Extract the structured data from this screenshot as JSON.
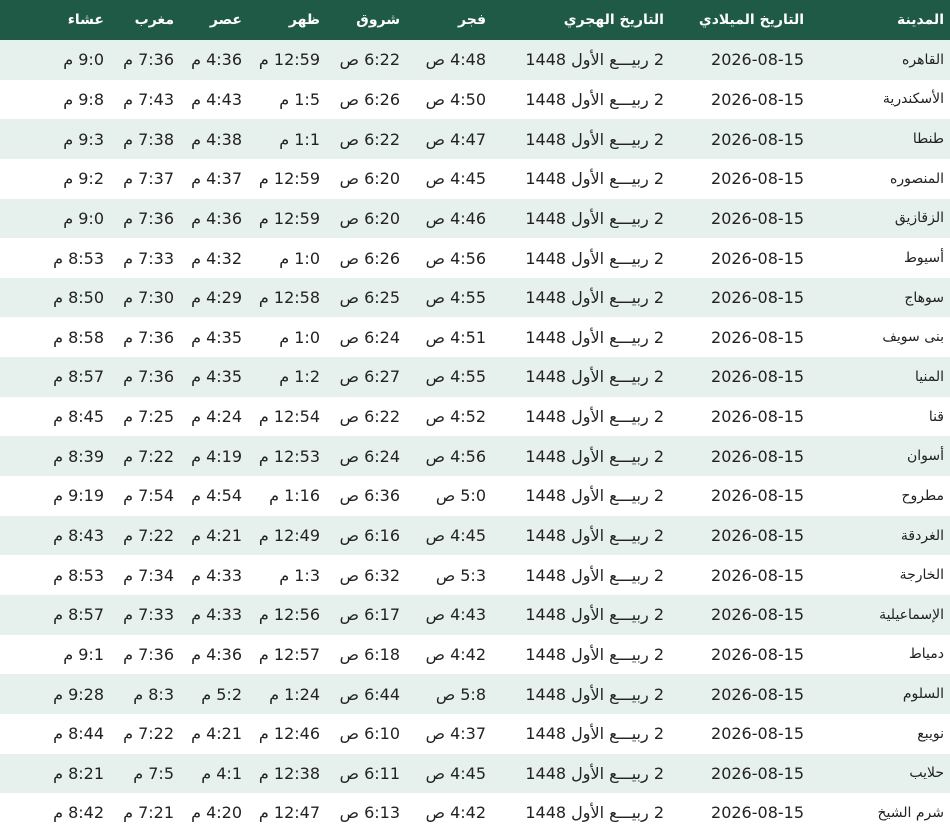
{
  "headers": {
    "city": "المدينة",
    "gregorian": "التاريخ الميلادي",
    "hijri": "التاريخ الهجري",
    "fajr": "فجر",
    "shuruq": "شروق",
    "dhuhr": "ظهر",
    "asr": "عصر",
    "maghrib": "مغرب",
    "isha": "عشاء"
  },
  "rows": [
    {
      "city": "القاهره",
      "gregorian": "2026-08-15",
      "hijri": "2 ربيـــع الأول 1448",
      "fajr": "4:48 ص",
      "shuruq": "6:22 ص",
      "dhuhr": "12:59 م",
      "asr": "4:36 م",
      "maghrib": "7:36 م",
      "isha": "9:0 م"
    },
    {
      "city": "الأسكندرية",
      "gregorian": "2026-08-15",
      "hijri": "2 ربيـــع الأول 1448",
      "fajr": "4:50 ص",
      "shuruq": "6:26 ص",
      "dhuhr": "1:5 م",
      "asr": "4:43 م",
      "maghrib": "7:43 م",
      "isha": "9:8 م"
    },
    {
      "city": "طنطا",
      "gregorian": "2026-08-15",
      "hijri": "2 ربيـــع الأول 1448",
      "fajr": "4:47 ص",
      "shuruq": "6:22 ص",
      "dhuhr": "1:1 م",
      "asr": "4:38 م",
      "maghrib": "7:38 م",
      "isha": "9:3 م"
    },
    {
      "city": "المنصوره",
      "gregorian": "2026-08-15",
      "hijri": "2 ربيـــع الأول 1448",
      "fajr": "4:45 ص",
      "shuruq": "6:20 ص",
      "dhuhr": "12:59 م",
      "asr": "4:37 م",
      "maghrib": "7:37 م",
      "isha": "9:2 م"
    },
    {
      "city": "الزقازيق",
      "gregorian": "2026-08-15",
      "hijri": "2 ربيـــع الأول 1448",
      "fajr": "4:46 ص",
      "shuruq": "6:20 ص",
      "dhuhr": "12:59 م",
      "asr": "4:36 م",
      "maghrib": "7:36 م",
      "isha": "9:0 م"
    },
    {
      "city": "أسيوط",
      "gregorian": "2026-08-15",
      "hijri": "2 ربيـــع الأول 1448",
      "fajr": "4:56 ص",
      "shuruq": "6:26 ص",
      "dhuhr": "1:0 م",
      "asr": "4:32 م",
      "maghrib": "7:33 م",
      "isha": "8:53 م"
    },
    {
      "city": "سوهاج",
      "gregorian": "2026-08-15",
      "hijri": "2 ربيـــع الأول 1448",
      "fajr": "4:55 ص",
      "shuruq": "6:25 ص",
      "dhuhr": "12:58 م",
      "asr": "4:29 م",
      "maghrib": "7:30 م",
      "isha": "8:50 م"
    },
    {
      "city": "بنى سويف",
      "gregorian": "2026-08-15",
      "hijri": "2 ربيـــع الأول 1448",
      "fajr": "4:51 ص",
      "shuruq": "6:24 ص",
      "dhuhr": "1:0 م",
      "asr": "4:35 م",
      "maghrib": "7:36 م",
      "isha": "8:58 م"
    },
    {
      "city": "المنيا",
      "gregorian": "2026-08-15",
      "hijri": "2 ربيـــع الأول 1448",
      "fajr": "4:55 ص",
      "shuruq": "6:27 ص",
      "dhuhr": "1:2 م",
      "asr": "4:35 م",
      "maghrib": "7:36 م",
      "isha": "8:57 م"
    },
    {
      "city": "قنا",
      "gregorian": "2026-08-15",
      "hijri": "2 ربيـــع الأول 1448",
      "fajr": "4:52 ص",
      "shuruq": "6:22 ص",
      "dhuhr": "12:54 م",
      "asr": "4:24 م",
      "maghrib": "7:25 م",
      "isha": "8:45 م"
    },
    {
      "city": "أسوان",
      "gregorian": "2026-08-15",
      "hijri": "2 ربيـــع الأول 1448",
      "fajr": "4:56 ص",
      "shuruq": "6:24 ص",
      "dhuhr": "12:53 م",
      "asr": "4:19 م",
      "maghrib": "7:22 م",
      "isha": "8:39 م"
    },
    {
      "city": "مطروح",
      "gregorian": "2026-08-15",
      "hijri": "2 ربيـــع الأول 1448",
      "fajr": "5:0 ص",
      "shuruq": "6:36 ص",
      "dhuhr": "1:16 م",
      "asr": "4:54 م",
      "maghrib": "7:54 م",
      "isha": "9:19 م"
    },
    {
      "city": "الغردقة",
      "gregorian": "2026-08-15",
      "hijri": "2 ربيـــع الأول 1448",
      "fajr": "4:45 ص",
      "shuruq": "6:16 ص",
      "dhuhr": "12:49 م",
      "asr": "4:21 م",
      "maghrib": "7:22 م",
      "isha": "8:43 م"
    },
    {
      "city": "الخارجة",
      "gregorian": "2026-08-15",
      "hijri": "2 ربيـــع الأول 1448",
      "fajr": "5:3 ص",
      "shuruq": "6:32 ص",
      "dhuhr": "1:3 م",
      "asr": "4:33 م",
      "maghrib": "7:34 م",
      "isha": "8:53 م"
    },
    {
      "city": "الإسماعيلية",
      "gregorian": "2026-08-15",
      "hijri": "2 ربيـــع الأول 1448",
      "fajr": "4:43 ص",
      "shuruq": "6:17 ص",
      "dhuhr": "12:56 م",
      "asr": "4:33 م",
      "maghrib": "7:33 م",
      "isha": "8:57 م"
    },
    {
      "city": "دمياط",
      "gregorian": "2026-08-15",
      "hijri": "2 ربيـــع الأول 1448",
      "fajr": "4:42 ص",
      "shuruq": "6:18 ص",
      "dhuhr": "12:57 م",
      "asr": "4:36 م",
      "maghrib": "7:36 م",
      "isha": "9:1 م"
    },
    {
      "city": "السلوم",
      "gregorian": "2026-08-15",
      "hijri": "2 ربيـــع الأول 1448",
      "fajr": "5:8 ص",
      "shuruq": "6:44 ص",
      "dhuhr": "1:24 م",
      "asr": "5:2 م",
      "maghrib": "8:3 م",
      "isha": "9:28 م"
    },
    {
      "city": "نويبع",
      "gregorian": "2026-08-15",
      "hijri": "2 ربيـــع الأول 1448",
      "fajr": "4:37 ص",
      "shuruq": "6:10 ص",
      "dhuhr": "12:46 م",
      "asr": "4:21 م",
      "maghrib": "7:22 م",
      "isha": "8:44 م"
    },
    {
      "city": "حلايب",
      "gregorian": "2026-08-15",
      "hijri": "2 ربيـــع الأول 1448",
      "fajr": "4:45 ص",
      "shuruq": "6:11 ص",
      "dhuhr": "12:38 م",
      "asr": "4:1 م",
      "maghrib": "7:5 م",
      "isha": "8:21 م"
    },
    {
      "city": "شرم الشيخ",
      "gregorian": "2026-08-15",
      "hijri": "2 ربيـــع الأول 1448",
      "fajr": "4:42 ص",
      "shuruq": "6:13 ص",
      "dhuhr": "12:47 م",
      "asr": "4:20 م",
      "maghrib": "7:21 م",
      "isha": "8:42 م"
    }
  ],
  "colors": {
    "header_bg": "#1f5a46",
    "stripe_bg": "#e6f0ec"
  }
}
